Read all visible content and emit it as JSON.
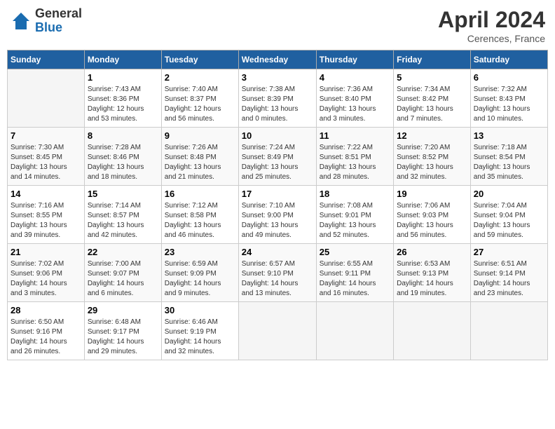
{
  "header": {
    "logo_text_general": "General",
    "logo_text_blue": "Blue",
    "main_title": "April 2024",
    "subtitle": "Cerences, France"
  },
  "calendar": {
    "days_of_week": [
      "Sunday",
      "Monday",
      "Tuesday",
      "Wednesday",
      "Thursday",
      "Friday",
      "Saturday"
    ],
    "weeks": [
      [
        {
          "day": "",
          "info": ""
        },
        {
          "day": "1",
          "info": "Sunrise: 7:43 AM\nSunset: 8:36 PM\nDaylight: 12 hours\nand 53 minutes."
        },
        {
          "day": "2",
          "info": "Sunrise: 7:40 AM\nSunset: 8:37 PM\nDaylight: 12 hours\nand 56 minutes."
        },
        {
          "day": "3",
          "info": "Sunrise: 7:38 AM\nSunset: 8:39 PM\nDaylight: 13 hours\nand 0 minutes."
        },
        {
          "day": "4",
          "info": "Sunrise: 7:36 AM\nSunset: 8:40 PM\nDaylight: 13 hours\nand 3 minutes."
        },
        {
          "day": "5",
          "info": "Sunrise: 7:34 AM\nSunset: 8:42 PM\nDaylight: 13 hours\nand 7 minutes."
        },
        {
          "day": "6",
          "info": "Sunrise: 7:32 AM\nSunset: 8:43 PM\nDaylight: 13 hours\nand 10 minutes."
        }
      ],
      [
        {
          "day": "7",
          "info": "Sunrise: 7:30 AM\nSunset: 8:45 PM\nDaylight: 13 hours\nand 14 minutes."
        },
        {
          "day": "8",
          "info": "Sunrise: 7:28 AM\nSunset: 8:46 PM\nDaylight: 13 hours\nand 18 minutes."
        },
        {
          "day": "9",
          "info": "Sunrise: 7:26 AM\nSunset: 8:48 PM\nDaylight: 13 hours\nand 21 minutes."
        },
        {
          "day": "10",
          "info": "Sunrise: 7:24 AM\nSunset: 8:49 PM\nDaylight: 13 hours\nand 25 minutes."
        },
        {
          "day": "11",
          "info": "Sunrise: 7:22 AM\nSunset: 8:51 PM\nDaylight: 13 hours\nand 28 minutes."
        },
        {
          "day": "12",
          "info": "Sunrise: 7:20 AM\nSunset: 8:52 PM\nDaylight: 13 hours\nand 32 minutes."
        },
        {
          "day": "13",
          "info": "Sunrise: 7:18 AM\nSunset: 8:54 PM\nDaylight: 13 hours\nand 35 minutes."
        }
      ],
      [
        {
          "day": "14",
          "info": "Sunrise: 7:16 AM\nSunset: 8:55 PM\nDaylight: 13 hours\nand 39 minutes."
        },
        {
          "day": "15",
          "info": "Sunrise: 7:14 AM\nSunset: 8:57 PM\nDaylight: 13 hours\nand 42 minutes."
        },
        {
          "day": "16",
          "info": "Sunrise: 7:12 AM\nSunset: 8:58 PM\nDaylight: 13 hours\nand 46 minutes."
        },
        {
          "day": "17",
          "info": "Sunrise: 7:10 AM\nSunset: 9:00 PM\nDaylight: 13 hours\nand 49 minutes."
        },
        {
          "day": "18",
          "info": "Sunrise: 7:08 AM\nSunset: 9:01 PM\nDaylight: 13 hours\nand 52 minutes."
        },
        {
          "day": "19",
          "info": "Sunrise: 7:06 AM\nSunset: 9:03 PM\nDaylight: 13 hours\nand 56 minutes."
        },
        {
          "day": "20",
          "info": "Sunrise: 7:04 AM\nSunset: 9:04 PM\nDaylight: 13 hours\nand 59 minutes."
        }
      ],
      [
        {
          "day": "21",
          "info": "Sunrise: 7:02 AM\nSunset: 9:06 PM\nDaylight: 14 hours\nand 3 minutes."
        },
        {
          "day": "22",
          "info": "Sunrise: 7:00 AM\nSunset: 9:07 PM\nDaylight: 14 hours\nand 6 minutes."
        },
        {
          "day": "23",
          "info": "Sunrise: 6:59 AM\nSunset: 9:09 PM\nDaylight: 14 hours\nand 9 minutes."
        },
        {
          "day": "24",
          "info": "Sunrise: 6:57 AM\nSunset: 9:10 PM\nDaylight: 14 hours\nand 13 minutes."
        },
        {
          "day": "25",
          "info": "Sunrise: 6:55 AM\nSunset: 9:11 PM\nDaylight: 14 hours\nand 16 minutes."
        },
        {
          "day": "26",
          "info": "Sunrise: 6:53 AM\nSunset: 9:13 PM\nDaylight: 14 hours\nand 19 minutes."
        },
        {
          "day": "27",
          "info": "Sunrise: 6:51 AM\nSunset: 9:14 PM\nDaylight: 14 hours\nand 23 minutes."
        }
      ],
      [
        {
          "day": "28",
          "info": "Sunrise: 6:50 AM\nSunset: 9:16 PM\nDaylight: 14 hours\nand 26 minutes."
        },
        {
          "day": "29",
          "info": "Sunrise: 6:48 AM\nSunset: 9:17 PM\nDaylight: 14 hours\nand 29 minutes."
        },
        {
          "day": "30",
          "info": "Sunrise: 6:46 AM\nSunset: 9:19 PM\nDaylight: 14 hours\nand 32 minutes."
        },
        {
          "day": "",
          "info": ""
        },
        {
          "day": "",
          "info": ""
        },
        {
          "day": "",
          "info": ""
        },
        {
          "day": "",
          "info": ""
        }
      ]
    ]
  }
}
